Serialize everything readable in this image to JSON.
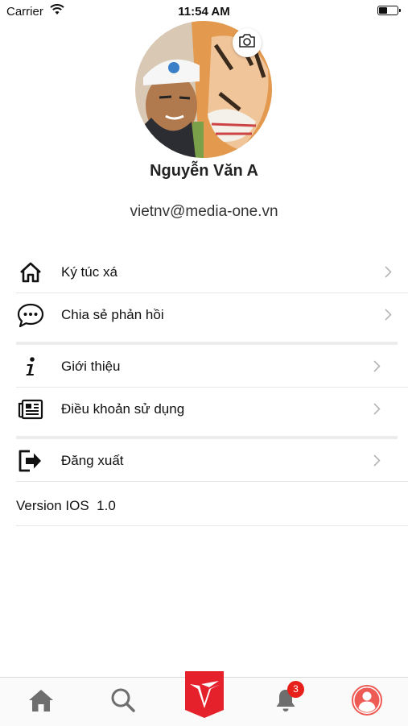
{
  "status_bar": {
    "carrier": "Carrier",
    "time": "11:54 AM",
    "battery_level": 0.4
  },
  "profile": {
    "name": "Nguyễn Văn A",
    "email": "vietnv@media-one.vn"
  },
  "menu": {
    "group1": [
      {
        "label": "Ký túc xá",
        "icon": "home-outline-icon"
      },
      {
        "label": "Chia sẻ phản hồi",
        "icon": "chat-bubble-icon"
      }
    ],
    "group2": [
      {
        "label": "Giới thiệu",
        "icon": "info-icon"
      },
      {
        "label": "Điều khoản sử dụng",
        "icon": "newspaper-icon"
      }
    ],
    "group3": [
      {
        "label": "Đăng xuất",
        "icon": "logout-icon"
      }
    ],
    "version": "Version IOS  1.0"
  },
  "tab_bar": {
    "notification_count": "3",
    "accent_color": "#e5212b",
    "icons": [
      "home-icon",
      "search-icon",
      "brand-logo",
      "bell-icon",
      "profile-icon"
    ]
  }
}
